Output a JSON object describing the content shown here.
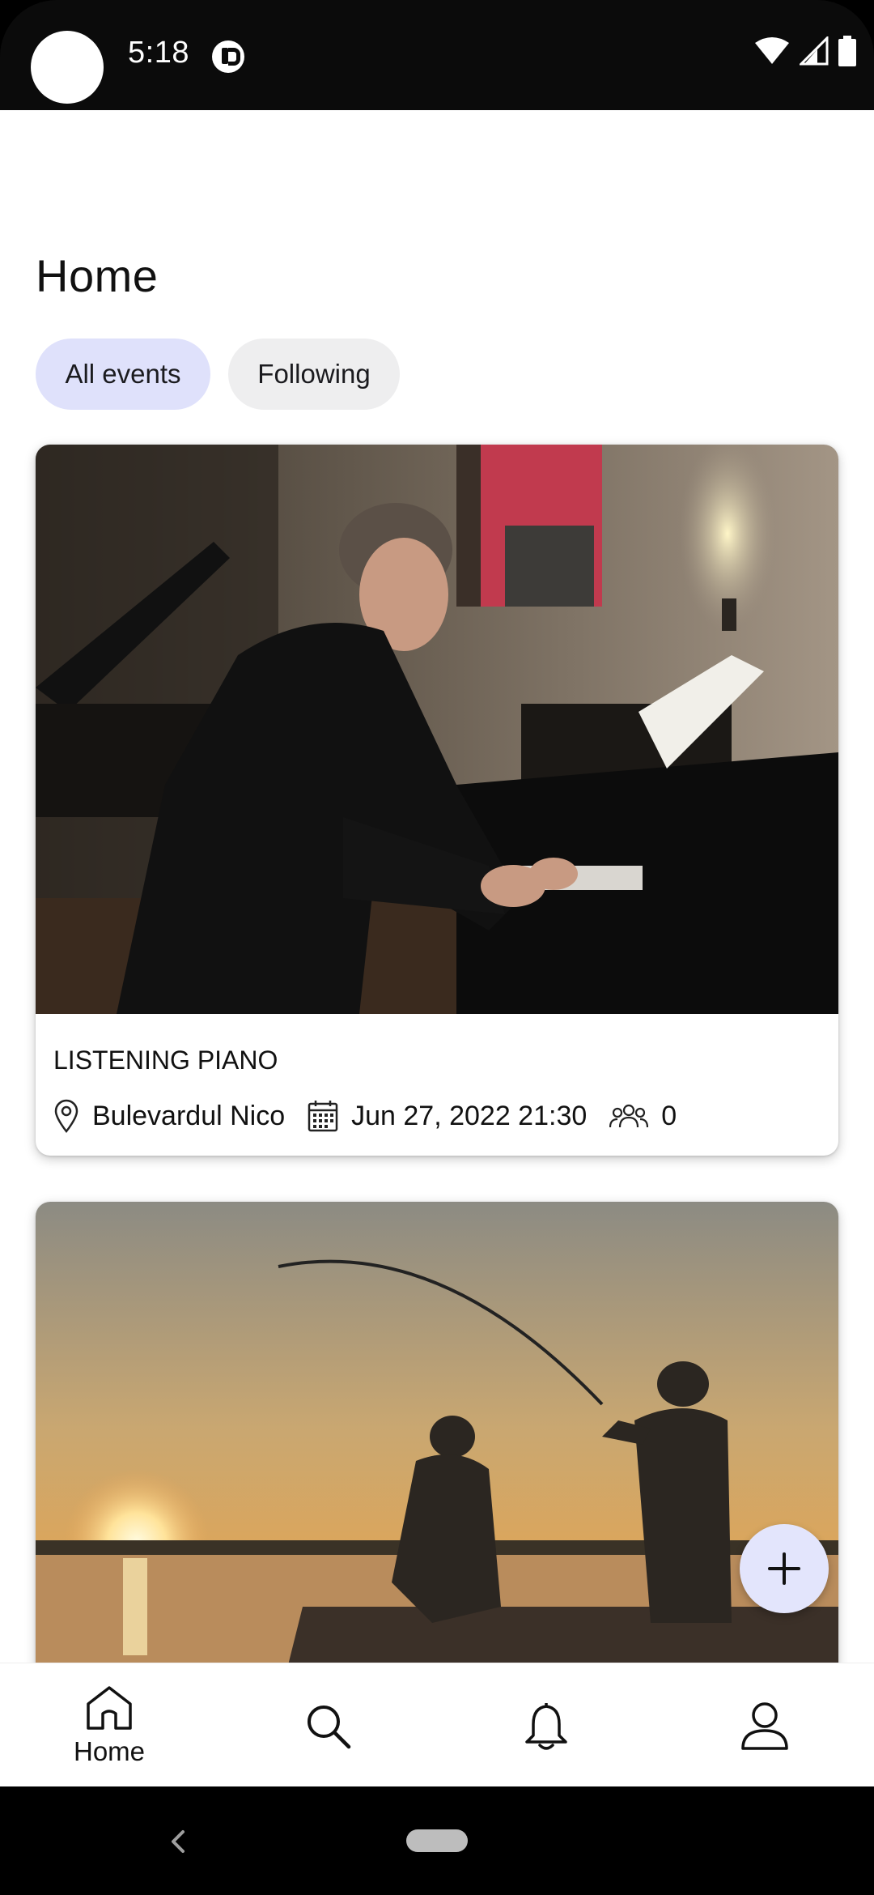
{
  "status_bar": {
    "time": "5:18"
  },
  "header": {
    "title": "Home"
  },
  "filters": [
    {
      "label": "All events",
      "selected": true
    },
    {
      "label": "Following",
      "selected": false
    }
  ],
  "events": [
    {
      "title": "LISTENING PIANO",
      "location": "Bulevardul Nico",
      "datetime": "Jun 27, 2022 21:30",
      "attendees": "0"
    }
  ],
  "bottom_nav": {
    "items": [
      {
        "label": "Home",
        "icon": "home-icon",
        "active": true
      },
      {
        "label": "",
        "icon": "search-icon",
        "active": false
      },
      {
        "label": "",
        "icon": "bell-icon",
        "active": false
      },
      {
        "label": "",
        "icon": "profile-icon",
        "active": false
      }
    ]
  },
  "colors": {
    "chip_selected": "#dfe1fb",
    "chip_default": "#eeeeef",
    "fab": "#e3e5fc"
  }
}
